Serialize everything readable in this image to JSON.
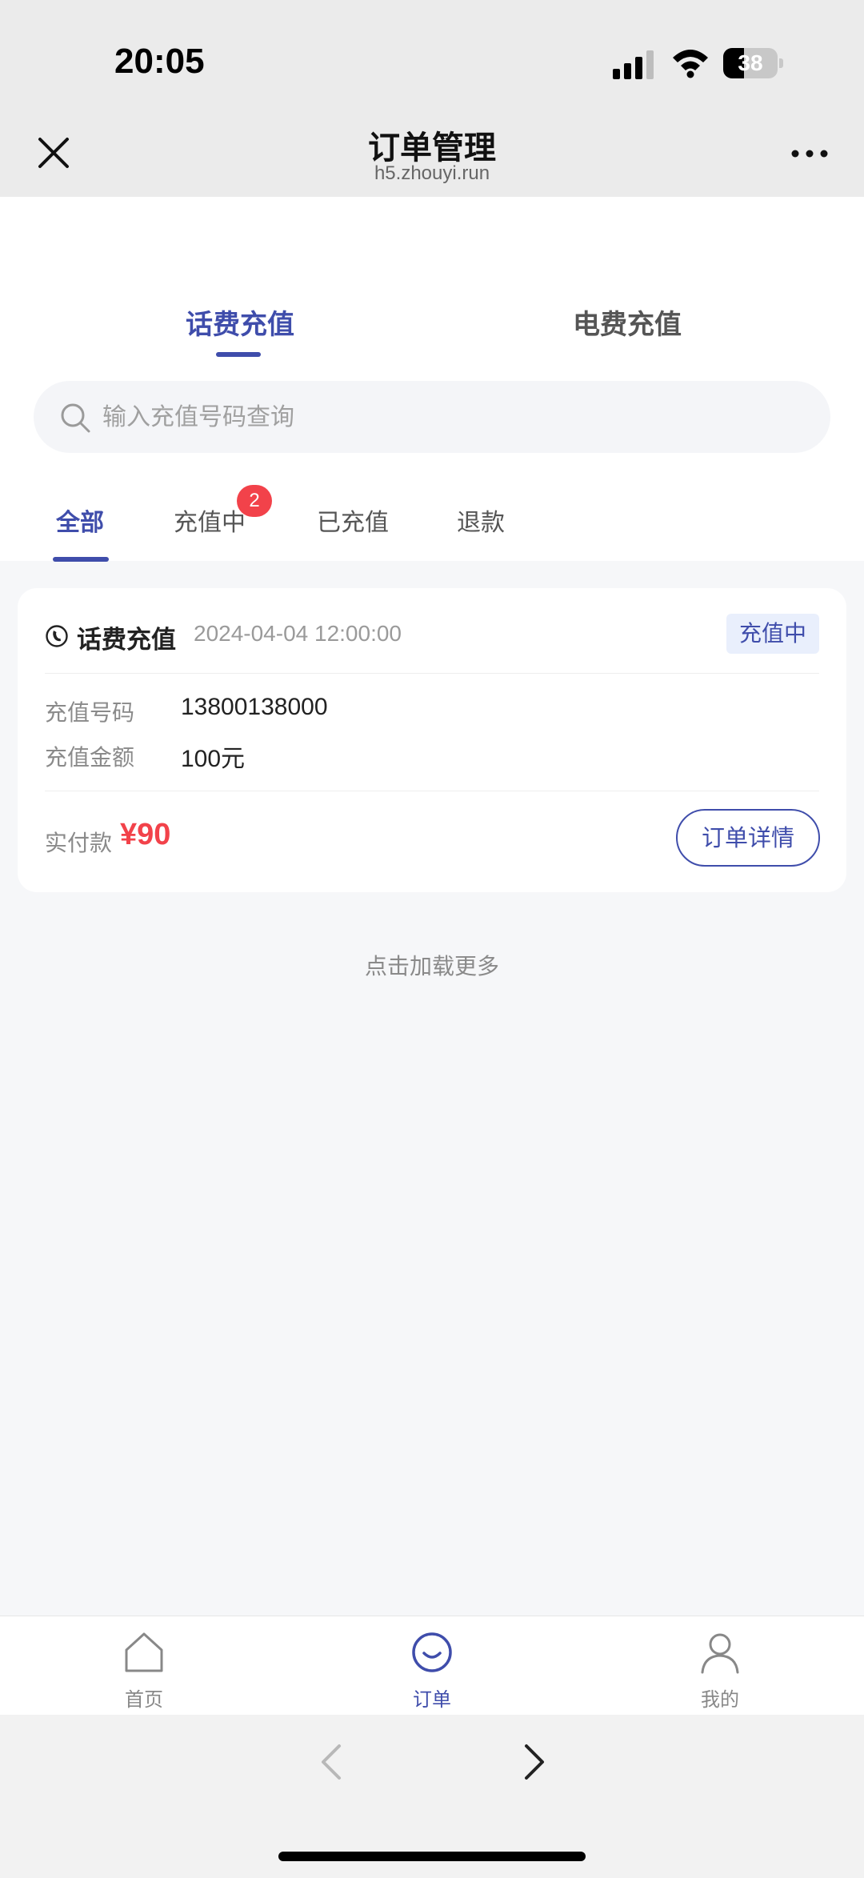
{
  "status_bar": {
    "time": "20:05",
    "battery": "38",
    "battery_level": 0.38
  },
  "nav": {
    "title": "订单管理",
    "subtitle": "h5.zhouyi.run",
    "close_icon": "close-icon",
    "more_icon": "more-icon"
  },
  "main_tabs": [
    {
      "label": "话费充值",
      "active": true
    },
    {
      "label": "电费充值",
      "active": false
    }
  ],
  "search": {
    "placeholder": "输入充值号码查询",
    "value": ""
  },
  "sub_tabs": [
    {
      "label": "全部",
      "active": true
    },
    {
      "label": "充值中",
      "badge": "2"
    },
    {
      "label": "已充值"
    },
    {
      "label": "退款"
    }
  ],
  "order": {
    "type": "话费充值",
    "time": "2024-04-04 12:00:00",
    "status": "充值中",
    "fields": [
      {
        "label": "充值号码",
        "value": "13800138000"
      },
      {
        "label": "充值金额",
        "value": "100元"
      }
    ],
    "paid_label": "实付款",
    "paid_value": "¥90",
    "detail_button": "订单详情"
  },
  "load_more": "点击加载更多",
  "tabbar": [
    {
      "label": "首页",
      "icon": "home-icon",
      "active": false
    },
    {
      "label": "订单",
      "icon": "order-icon",
      "active": true
    },
    {
      "label": "我的",
      "icon": "profile-icon",
      "active": false
    }
  ],
  "colors": {
    "accent": "#3f4dab",
    "danger": "#f2424a",
    "status_bg": "#e9effc"
  }
}
